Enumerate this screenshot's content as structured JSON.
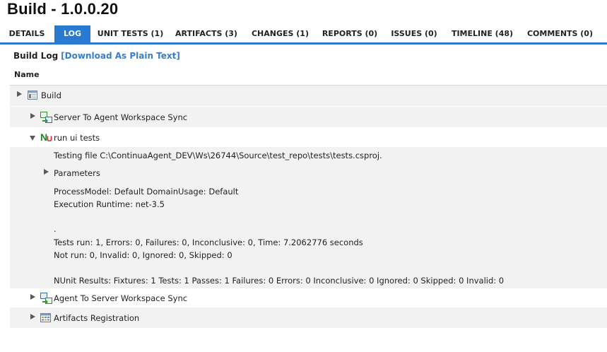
{
  "page_title": "Build - 1.0.0.20",
  "tabs": [
    {
      "label": "DETAILS"
    },
    {
      "label": "LOG"
    },
    {
      "label": "UNIT TESTS (1)"
    },
    {
      "label": "ARTIFACTS (3)"
    },
    {
      "label": "CHANGES (1)"
    },
    {
      "label": "REPORTS (0)"
    },
    {
      "label": "ISSUES (0)"
    },
    {
      "label": "TIMELINE (48)"
    },
    {
      "label": "COMMENTS (0)"
    }
  ],
  "active_tab": "LOG",
  "log": {
    "heading": "Build Log",
    "download_link": "[Download As Plain Text]",
    "column_name": "Name"
  },
  "tree": {
    "build": "Build",
    "server_sync": "Server To Agent Workspace Sync",
    "run_tests": "run ui tests",
    "testing_file": "Testing file C:\\ContinuaAgent_DEV\\Ws\\26744\\Source\\test_repo\\tests\\tests.csproj.",
    "parameters": "Parameters",
    "process_model": "ProcessModel: Default DomainUsage: Default",
    "execution_runtime": "Execution Runtime: net-3.5",
    "dot": ".",
    "tests_run": "Tests run: 1, Errors: 0, Failures: 0, Inconclusive: 0, Time: 7.2062776 seconds",
    "not_run": "Not run: 0, Invalid: 0, Ignored: 0, Skipped: 0",
    "nunit_results": "NUnit Results: Fixtures: 1 Tests: 1 Passes: 1 Failures: 0 Errors: 0 Inconclusive: 0 Ignored: 0 Skipped: 0 Invalid: 0",
    "agent_sync": "Agent To Server Workspace Sync",
    "artifacts_registration": "Artifacts Registration"
  },
  "colors": {
    "accent": "#2a7ad1",
    "link": "#3b7dc6",
    "band": "#f2f2f2"
  }
}
